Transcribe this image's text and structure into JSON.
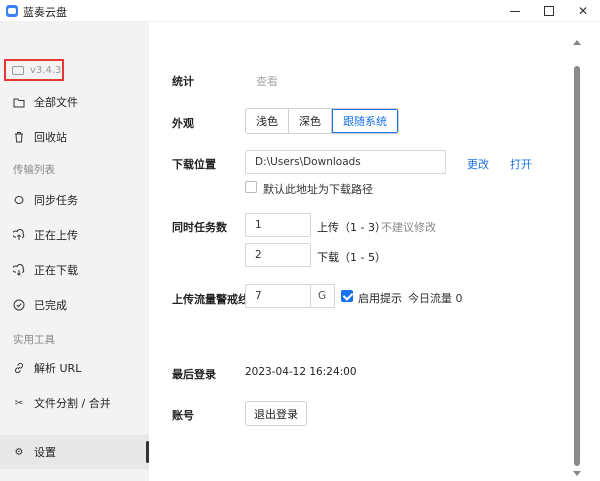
{
  "window": {
    "title": "蓝奏云盘"
  },
  "sidebar": {
    "version": "v3.4.3",
    "items": [
      {
        "label": "全部文件",
        "icon": "folder-icon"
      },
      {
        "label": "回收站",
        "icon": "trash-icon"
      },
      {
        "label": "同步任务",
        "icon": "sync-icon"
      },
      {
        "label": "正在上传",
        "icon": "upload-icon"
      },
      {
        "label": "正在下载",
        "icon": "download-icon"
      },
      {
        "label": "已完成",
        "icon": "check-circle-icon"
      },
      {
        "label": "解析 URL",
        "icon": "link-icon"
      },
      {
        "label": "文件分割 / 合并",
        "icon": "scissors-icon"
      },
      {
        "label": "设置",
        "icon": "gear-icon"
      }
    ],
    "sections": {
      "transfer": "传输列表",
      "tools": "实用工具"
    },
    "active": "设置"
  },
  "settings": {
    "stats": {
      "label": "统计",
      "value": "查看"
    },
    "appearance": {
      "label": "外观",
      "options": [
        "浅色",
        "深色",
        "跟随系统"
      ],
      "selected": "跟随系统"
    },
    "download": {
      "label": "下载位置",
      "path": "D:\\Users\\Downloads",
      "change": "更改",
      "open": "打开",
      "default_checkbox": "默认此地址为下载路径",
      "default_checked": false
    },
    "concurrency": {
      "label": "同时任务数",
      "upload_value": "1",
      "upload_label": "上传（1 - 3）",
      "upload_hint": "不建议修改",
      "download_value": "2",
      "download_label": "下载（1 - 5）"
    },
    "upload_limit": {
      "label": "上传流量警戒线",
      "value": "7",
      "unit": "G",
      "enable_label": "启用提示",
      "enabled": true,
      "today_flow": "今日流量 0"
    },
    "last_login": {
      "label": "最后登录",
      "value": "2023-04-12 16:24:00"
    },
    "account": {
      "label": "账号",
      "logout": "退出登录"
    }
  },
  "colors": {
    "accent": "#1a73e8",
    "highlight_box": "#e53935",
    "sidebar_bg": "#f3f3f3"
  }
}
